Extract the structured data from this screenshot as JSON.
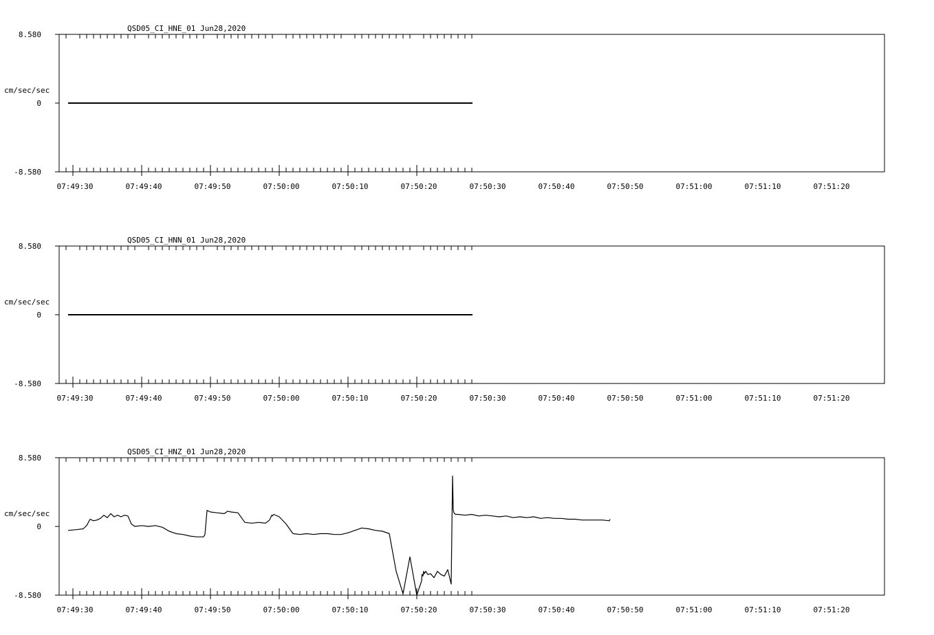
{
  "chart_data": [
    {
      "type": "line",
      "title": "QSD05_CI_HNE_01  Jun28,2020",
      "ylabel": "cm/sec/sec",
      "ylim": [
        -8.58,
        8.58
      ],
      "yticks": [
        "8.580",
        "0",
        "-8.580"
      ],
      "xticks": [
        "07:49:30",
        "07:49:40",
        "07:49:50",
        "07:50:00",
        "07:50:10",
        "07:50:20",
        "07:50:30",
        "07:50:40",
        "07:50:50",
        "07:51:00",
        "07:51:10",
        "07:51:20"
      ],
      "xrange_seconds_from_first_tick": [
        -1.9,
        58.1
      ],
      "series": [
        {
          "x": [
            -0.7,
            58.1
          ],
          "y": [
            0,
            0
          ]
        }
      ]
    },
    {
      "type": "line",
      "title": "QSD05_CI_HNN_01  Jun28,2020",
      "ylabel": "cm/sec/sec",
      "ylim": [
        -8.58,
        8.58
      ],
      "yticks": [
        "8.580",
        "0",
        "-8.580"
      ],
      "xticks": [
        "07:49:30",
        "07:49:40",
        "07:49:50",
        "07:50:00",
        "07:50:10",
        "07:50:20",
        "07:50:30",
        "07:50:40",
        "07:50:50",
        "07:51:00",
        "07:51:10",
        "07:51:20"
      ],
      "xrange_seconds_from_first_tick": [
        -1.9,
        58.1
      ],
      "series": [
        {
          "x": [
            -0.7,
            58.1
          ],
          "y": [
            0,
            0
          ]
        }
      ]
    },
    {
      "type": "line",
      "title": "QSD05_CI_HNZ_01  Jun28,2020",
      "ylabel": "cm/sec/sec",
      "ylim": [
        -8.58,
        8.58
      ],
      "yticks": [
        "8.580",
        "0",
        "-8.580"
      ],
      "xticks": [
        "07:49:30",
        "07:49:40",
        "07:49:50",
        "07:50:00",
        "07:50:10",
        "07:50:20",
        "07:50:30",
        "07:50:40",
        "07:50:50",
        "07:51:00",
        "07:51:10",
        "07:51:20"
      ],
      "xrange_seconds_from_first_tick": [
        -1.9,
        58.1
      ],
      "series": [
        {
          "x": [
            -0.7,
            0.5,
            1.5,
            2.0,
            2.5,
            3.0,
            3.5,
            4.0,
            4.5,
            5.0,
            5.5,
            6.0,
            6.5,
            7.0,
            7.5,
            8.0,
            8.5,
            9.0,
            10.0,
            11.0,
            12.0,
            13.0,
            14.0,
            15.0,
            16.0,
            17.0,
            18.0,
            19.0,
            19.2,
            19.5,
            20.0,
            21.0,
            22.0,
            22.5,
            23.0,
            24.0,
            25.0,
            26.0,
            27.0,
            28.0,
            28.6,
            28.9,
            29.0,
            29.2,
            30.0,
            31.0,
            32.0,
            33.0,
            34.0,
            35.0,
            36.0,
            37.0,
            38.0,
            39.0,
            40.0,
            41.0,
            42.0,
            43.0,
            44.0,
            45.0,
            46.0,
            47.0,
            48.0,
            49.0,
            50.0,
            50.7,
            50.75,
            50.8,
            50.9,
            51.0,
            51.1,
            51.3,
            51.6,
            52.0,
            52.5,
            53.0,
            53.5,
            54.0,
            54.5,
            55.0,
            55.2,
            55.3,
            55.35,
            55.4,
            55.6,
            56.0,
            57.0,
            58.0,
            59.0,
            60.0,
            61.0,
            62.0,
            63.0,
            64.0,
            65.0,
            66.0,
            67.0,
            68.0,
            69.0,
            70.0,
            71.0,
            72.0,
            73.0,
            74.0,
            75.0,
            76.0,
            77.0,
            78.0,
            78.1
          ],
          "y": [
            -0.5,
            -0.4,
            -0.3,
            0.1,
            0.9,
            0.7,
            0.8,
            1.0,
            1.4,
            1.1,
            1.6,
            1.2,
            1.4,
            1.2,
            1.4,
            1.3,
            0.3,
            0.0,
            0.1,
            0.0,
            0.1,
            -0.1,
            -0.6,
            -0.9,
            -1.0,
            -1.2,
            -1.3,
            -1.3,
            -1.0,
            2.0,
            1.8,
            1.7,
            1.6,
            1.9,
            1.8,
            1.7,
            0.5,
            0.4,
            0.5,
            0.4,
            0.8,
            1.4,
            1.3,
            1.5,
            1.2,
            0.3,
            -0.9,
            -1.0,
            -0.9,
            -1.0,
            -0.9,
            -0.9,
            -1.0,
            -1.0,
            -0.8,
            -0.5,
            -0.2,
            -0.3,
            -0.5,
            -0.6,
            -0.9,
            -5.6,
            -8.4,
            -3.8,
            -8.6,
            -6.8,
            -6.0,
            -6.0,
            -6.2,
            -5.6,
            -5.9,
            -5.6,
            -6.0,
            -5.9,
            -6.4,
            -5.6,
            -6.0,
            -6.2,
            -5.4,
            -7.2,
            6.3,
            2.1,
            1.9,
            1.7,
            1.5,
            1.5,
            1.4,
            1.5,
            1.3,
            1.4,
            1.3,
            1.2,
            1.3,
            1.1,
            1.2,
            1.1,
            1.2,
            1.0,
            1.1,
            1.0,
            1.0,
            0.9,
            0.9,
            0.8,
            0.8,
            0.8,
            0.8,
            0.7,
            0.9
          ]
        }
      ]
    }
  ]
}
